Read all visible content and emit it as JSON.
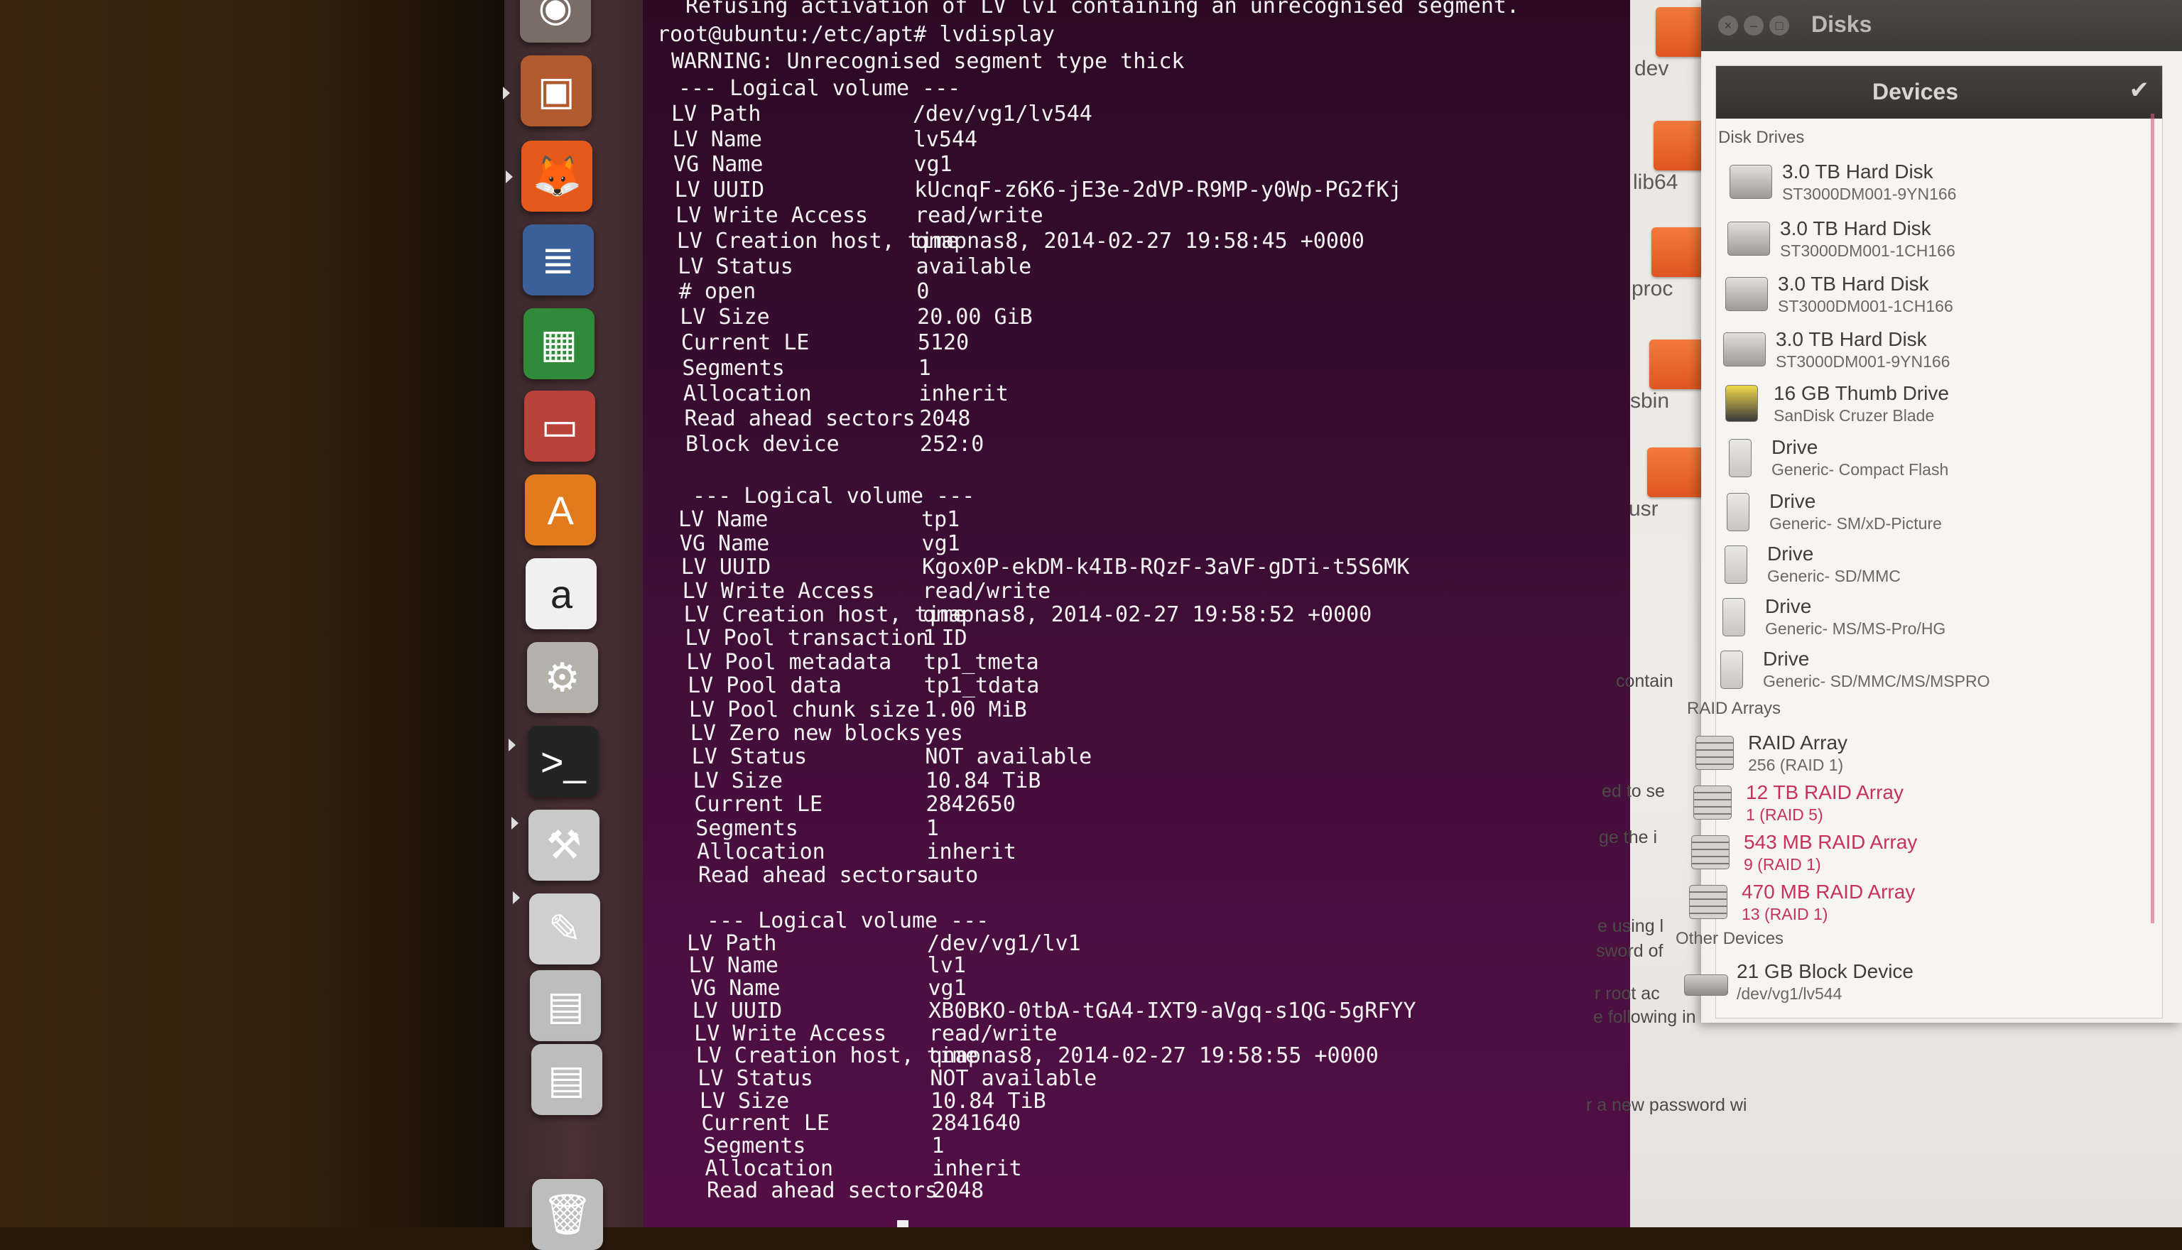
{
  "launcher": {
    "items": [
      {
        "name": "dash-home-icon",
        "glyph": "◉"
      },
      {
        "name": "files-icon",
        "glyph": "▣"
      },
      {
        "name": "firefox-icon",
        "glyph": "🦊"
      },
      {
        "name": "writer-icon",
        "glyph": "≣"
      },
      {
        "name": "calc-icon",
        "glyph": "▦"
      },
      {
        "name": "impress-icon",
        "glyph": "▭"
      },
      {
        "name": "software-center-icon",
        "glyph": "A"
      },
      {
        "name": "amazon-icon",
        "glyph": "a"
      },
      {
        "name": "system-settings-icon",
        "glyph": "⚙"
      },
      {
        "name": "terminal-icon",
        "glyph": ">_"
      },
      {
        "name": "disks-utility-icon",
        "glyph": "⚒"
      },
      {
        "name": "text-editor-icon",
        "glyph": "✎"
      },
      {
        "name": "drive-icon-1",
        "glyph": "▤"
      },
      {
        "name": "drive-icon-2",
        "glyph": "▤"
      },
      {
        "name": "trash-icon",
        "glyph": "🗑"
      }
    ]
  },
  "terminal": {
    "header_line": "Refusing activation of LV lv1 containing an unrecognised segment.",
    "prompt": "root@ubuntu:/etc/apt# lvdisplay",
    "warning": "WARNING: Unrecognised segment type thick",
    "volumes": [
      {
        "heading": "--- Logical volume ---",
        "fields": [
          [
            "LV Path",
            "/dev/vg1/lv544"
          ],
          [
            "LV Name",
            "lv544"
          ],
          [
            "VG Name",
            "vg1"
          ],
          [
            "LV UUID",
            "kUcnqF-z6K6-jE3e-2dVP-R9MP-y0Wp-PG2fKj"
          ],
          [
            "LV Write Access",
            "read/write"
          ],
          [
            "LV Creation host, time",
            "qnapnas8, 2014-02-27 19:58:45 +0000"
          ],
          [
            "LV Status",
            "available"
          ],
          [
            "# open",
            "0"
          ],
          [
            "LV Size",
            "20.00 GiB"
          ],
          [
            "Current LE",
            "5120"
          ],
          [
            "Segments",
            "1"
          ],
          [
            "Allocation",
            "inherit"
          ],
          [
            "Read ahead sectors",
            "2048"
          ],
          [
            "Block device",
            "252:0"
          ]
        ]
      },
      {
        "heading": "--- Logical volume ---",
        "fields": [
          [
            "LV Name",
            "tp1"
          ],
          [
            "VG Name",
            "vg1"
          ],
          [
            "LV UUID",
            "Kgox0P-ekDM-k4IB-RQzF-3aVF-gDTi-t5S6MK"
          ],
          [
            "LV Write Access",
            "read/write"
          ],
          [
            "LV Creation host, time",
            "qnapnas8, 2014-02-27 19:58:52 +0000"
          ],
          [
            "LV Pool transaction ID",
            "1"
          ],
          [
            "LV Pool metadata",
            "tp1_tmeta"
          ],
          [
            "LV Pool data",
            "tp1_tdata"
          ],
          [
            "LV Pool chunk size",
            "1.00 MiB"
          ],
          [
            "LV Zero new blocks",
            "yes"
          ],
          [
            "LV Status",
            "NOT available"
          ],
          [
            "LV Size",
            "10.84 TiB"
          ],
          [
            "Current LE",
            "2842650"
          ],
          [
            "Segments",
            "1"
          ],
          [
            "Allocation",
            "inherit"
          ],
          [
            "Read ahead sectors",
            "auto"
          ]
        ]
      },
      {
        "heading": "--- Logical volume ---",
        "fields": [
          [
            "LV Path",
            "/dev/vg1/lv1"
          ],
          [
            "LV Name",
            "lv1"
          ],
          [
            "VG Name",
            "vg1"
          ],
          [
            "LV UUID",
            "XB0BKO-0tbA-tGA4-IXT9-aVgq-s1QG-5gRFYY"
          ],
          [
            "LV Write Access",
            "read/write"
          ],
          [
            "LV Creation host, time",
            "qnapnas8, 2014-02-27 19:58:55 +0000"
          ],
          [
            "LV Status",
            "NOT available"
          ],
          [
            "LV Size",
            "10.84 TiB"
          ],
          [
            "Current LE",
            "2841640"
          ],
          [
            "Segments",
            "1"
          ],
          [
            "Allocation",
            "inherit"
          ],
          [
            "Read ahead sectors",
            "2048"
          ]
        ]
      }
    ]
  },
  "file_manager": {
    "folders": [
      "dev",
      "lib64",
      "proc",
      "sbin",
      "usr"
    ],
    "fragments": [
      "contain",
      "ed to se",
      "ge the i",
      "e using l",
      "sword of",
      "r root ac",
      "e following in a root",
      "r a new password wi"
    ]
  },
  "disks": {
    "title": "Disks",
    "devices_header": "Devices",
    "sections": {
      "disk_drives": "Disk Drives",
      "raid_arrays": "RAID Arrays",
      "other_devices": "Other Devices"
    },
    "disk_drives": [
      {
        "title": "3.0 TB Hard Disk",
        "sub": "ST3000DM001-9YN166",
        "icon": "hdd"
      },
      {
        "title": "3.0 TB Hard Disk",
        "sub": "ST3000DM001-1CH166",
        "icon": "hdd"
      },
      {
        "title": "3.0 TB Hard Disk",
        "sub": "ST3000DM001-1CH166",
        "icon": "hdd"
      },
      {
        "title": "3.0 TB Hard Disk",
        "sub": "ST3000DM001-9YN166",
        "icon": "hdd"
      },
      {
        "title": "16 GB Thumb Drive",
        "sub": "SanDisk Cruzer Blade",
        "icon": "thumb"
      },
      {
        "title": "Drive",
        "sub": "Generic- Compact Flash",
        "icon": "usb"
      },
      {
        "title": "Drive",
        "sub": "Generic- SM/xD-Picture",
        "icon": "usb"
      },
      {
        "title": "Drive",
        "sub": "Generic- SD/MMC",
        "icon": "usb"
      },
      {
        "title": "Drive",
        "sub": "Generic- MS/MS-Pro/HG",
        "icon": "usb"
      },
      {
        "title": "Drive",
        "sub": "Generic- SD/MMC/MS/MSPRO",
        "icon": "usb"
      }
    ],
    "raid_arrays": [
      {
        "title": "RAID Array",
        "sub": "256 (RAID 1)",
        "degraded": false
      },
      {
        "title": "12 TB RAID Array",
        "sub": "1 (RAID 5)",
        "degraded": true
      },
      {
        "title": "543 MB RAID Array",
        "sub": "9 (RAID 1)",
        "degraded": true
      },
      {
        "title": "470 MB RAID Array",
        "sub": "13 (RAID 1)",
        "degraded": true
      }
    ],
    "other_devices": [
      {
        "title": "21 GB Block Device",
        "sub": "/dev/vg1/lv544"
      }
    ]
  },
  "colors": {
    "terminal_bg_top": "#2c0a24",
    "terminal_bg_bottom": "#520f45",
    "degraded_red": "#c8325a"
  }
}
